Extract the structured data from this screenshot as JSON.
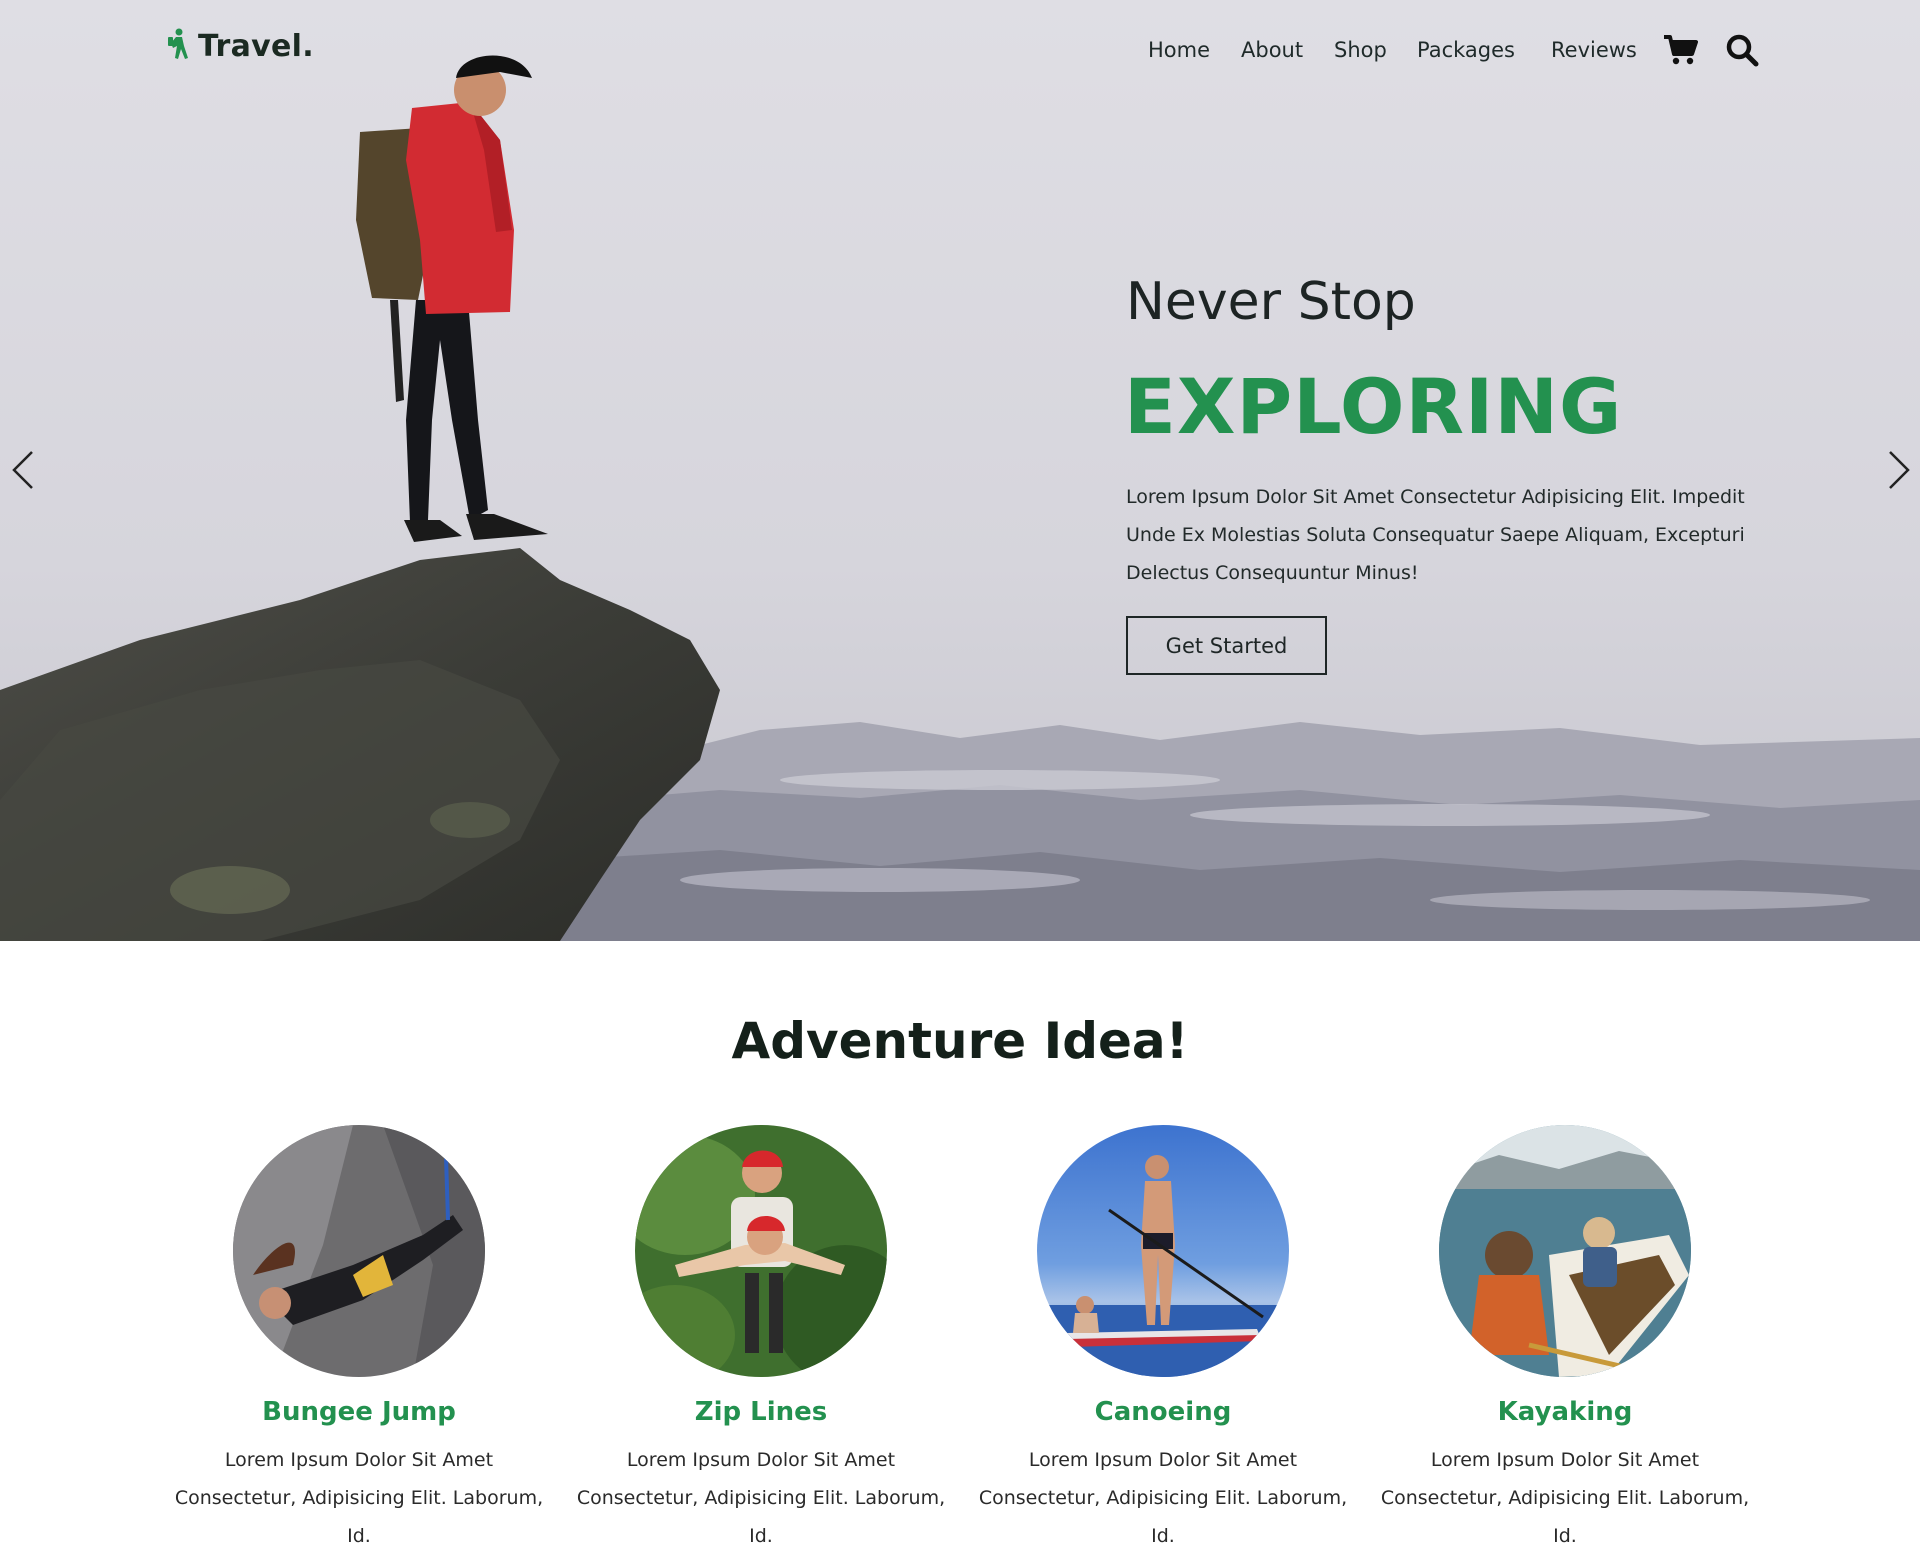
{
  "header": {
    "logo_text": "Travel.",
    "nav": [
      "Home",
      "About",
      "Shop",
      "Packages",
      "Reviews"
    ],
    "icons": [
      "cart-icon",
      "search-icon"
    ]
  },
  "hero": {
    "subtitle": "Never Stop",
    "title": "EXPLORING",
    "description": "Lorem Ipsum Dolor Sit Amet Consectetur Adipisicing Elit. Impedit Unde Ex Molestias Soluta Consequatur Saepe Aliquam, Excepturi Delectus Consequuntur Minus!",
    "button_label": "Get Started",
    "prev_icon": "chevron-left-icon",
    "next_icon": "chevron-right-icon"
  },
  "adventure": {
    "title": "Adventure Idea!",
    "cards": [
      {
        "title": "Bungee Jump",
        "text": "Lorem Ipsum Dolor Sit Amet Consectetur, Adipisicing Elit. Laborum, Id."
      },
      {
        "title": "Zip Lines",
        "text": "Lorem Ipsum Dolor Sit Amet Consectetur, Adipisicing Elit. Laborum, Id."
      },
      {
        "title": "Canoeing",
        "text": "Lorem Ipsum Dolor Sit Amet Consectetur, Adipisicing Elit. Laborum, Id."
      },
      {
        "title": "Kayaking",
        "text": "Lorem Ipsum Dolor Sit Amet Consectetur, Adipisicing Elit. Laborum, Id."
      }
    ]
  },
  "colors": {
    "accent_green": "#23914f",
    "text_dark": "#1d2424"
  }
}
